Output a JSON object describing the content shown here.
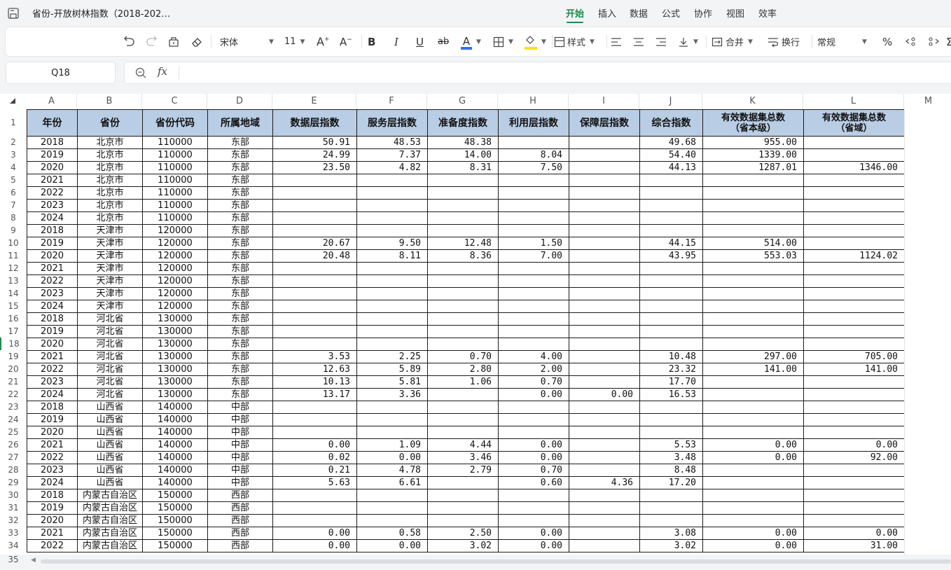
{
  "app": {
    "doc_title": "省份-开放树林指数（2018-202…",
    "menu_tabs": [
      "开始",
      "插入",
      "数据",
      "公式",
      "协作",
      "视图",
      "效率"
    ],
    "active_tab": "开始"
  },
  "toolbar": {
    "font_name": "宋体",
    "font_size": "11",
    "style_label": "样式",
    "merge_label": "合并",
    "wrap_label": "换行",
    "number_format": "常规",
    "percent": "%",
    "bold": "B",
    "italic": "I",
    "underline": "U",
    "strike": "ab",
    "font_color_glyph": "A",
    "accent_color": "#1f8a4c",
    "font_color_bar": "#3370ff",
    "fill_color_bar": "#ffe100"
  },
  "formula_bar": {
    "cell_ref": "Q18",
    "fx": "fx",
    "value": ""
  },
  "sheet": {
    "column_letters": [
      "A",
      "B",
      "C",
      "D",
      "E",
      "F",
      "G",
      "H",
      "I",
      "J",
      "K",
      "L",
      "M"
    ],
    "headers": [
      "年份",
      "省份",
      "省份代码",
      "所属地域",
      "数据层指数",
      "服务层指数",
      "准备度指数",
      "利用层指数",
      "保障层指数",
      "综合指数",
      "有效数据集总数\n（省本级）",
      "有效数据集总数\n（省域）"
    ],
    "rows": [
      [
        "2018",
        "北京市",
        "110000",
        "东部",
        "50.91",
        "48.53",
        "48.38",
        "",
        "",
        "49.68",
        "955.00",
        ""
      ],
      [
        "2019",
        "北京市",
        "110000",
        "东部",
        "24.99",
        "7.37",
        "14.00",
        "8.04",
        "",
        "54.40",
        "1339.00",
        ""
      ],
      [
        "2020",
        "北京市",
        "110000",
        "东部",
        "23.50",
        "4.82",
        "8.31",
        "7.50",
        "",
        "44.13",
        "1287.01",
        "1346.00"
      ],
      [
        "2021",
        "北京市",
        "110000",
        "东部",
        "",
        "",
        "",
        "",
        "",
        "",
        "",
        ""
      ],
      [
        "2022",
        "北京市",
        "110000",
        "东部",
        "",
        "",
        "",
        "",
        "",
        "",
        "",
        ""
      ],
      [
        "2023",
        "北京市",
        "110000",
        "东部",
        "",
        "",
        "",
        "",
        "",
        "",
        "",
        ""
      ],
      [
        "2024",
        "北京市",
        "110000",
        "东部",
        "",
        "",
        "",
        "",
        "",
        "",
        "",
        ""
      ],
      [
        "2018",
        "天津市",
        "120000",
        "东部",
        "",
        "",
        "",
        "",
        "",
        "",
        "",
        ""
      ],
      [
        "2019",
        "天津市",
        "120000",
        "东部",
        "20.67",
        "9.50",
        "12.48",
        "1.50",
        "",
        "44.15",
        "514.00",
        ""
      ],
      [
        "2020",
        "天津市",
        "120000",
        "东部",
        "20.48",
        "8.11",
        "8.36",
        "7.00",
        "",
        "43.95",
        "553.03",
        "1124.02"
      ],
      [
        "2021",
        "天津市",
        "120000",
        "东部",
        "",
        "",
        "",
        "",
        "",
        "",
        "",
        ""
      ],
      [
        "2022",
        "天津市",
        "120000",
        "东部",
        "",
        "",
        "",
        "",
        "",
        "",
        "",
        ""
      ],
      [
        "2023",
        "天津市",
        "120000",
        "东部",
        "",
        "",
        "",
        "",
        "",
        "",
        "",
        ""
      ],
      [
        "2024",
        "天津市",
        "120000",
        "东部",
        "",
        "",
        "",
        "",
        "",
        "",
        "",
        ""
      ],
      [
        "2018",
        "河北省",
        "130000",
        "东部",
        "",
        "",
        "",
        "",
        "",
        "",
        "",
        ""
      ],
      [
        "2019",
        "河北省",
        "130000",
        "东部",
        "",
        "",
        "",
        "",
        "",
        "",
        "",
        ""
      ],
      [
        "2020",
        "河北省",
        "130000",
        "东部",
        "",
        "",
        "",
        "",
        "",
        "",
        "",
        ""
      ],
      [
        "2021",
        "河北省",
        "130000",
        "东部",
        "3.53",
        "2.25",
        "0.70",
        "4.00",
        "",
        "10.48",
        "297.00",
        "705.00"
      ],
      [
        "2022",
        "河北省",
        "130000",
        "东部",
        "12.63",
        "5.89",
        "2.80",
        "2.00",
        "",
        "23.32",
        "141.00",
        "141.00"
      ],
      [
        "2023",
        "河北省",
        "130000",
        "东部",
        "10.13",
        "5.81",
        "1.06",
        "0.70",
        "",
        "17.70",
        "",
        ""
      ],
      [
        "2024",
        "河北省",
        "130000",
        "东部",
        "13.17",
        "3.36",
        "",
        "0.00",
        "0.00",
        "16.53",
        "",
        ""
      ],
      [
        "2018",
        "山西省",
        "140000",
        "中部",
        "",
        "",
        "",
        "",
        "",
        "",
        "",
        ""
      ],
      [
        "2019",
        "山西省",
        "140000",
        "中部",
        "",
        "",
        "",
        "",
        "",
        "",
        "",
        ""
      ],
      [
        "2020",
        "山西省",
        "140000",
        "中部",
        "",
        "",
        "",
        "",
        "",
        "",
        "",
        ""
      ],
      [
        "2021",
        "山西省",
        "140000",
        "中部",
        "0.00",
        "1.09",
        "4.44",
        "0.00",
        "",
        "5.53",
        "0.00",
        "0.00"
      ],
      [
        "2022",
        "山西省",
        "140000",
        "中部",
        "0.02",
        "0.00",
        "3.46",
        "0.00",
        "",
        "3.48",
        "0.00",
        "92.00"
      ],
      [
        "2023",
        "山西省",
        "140000",
        "中部",
        "0.21",
        "4.78",
        "2.79",
        "0.70",
        "",
        "8.48",
        "",
        ""
      ],
      [
        "2024",
        "山西省",
        "140000",
        "中部",
        "5.63",
        "6.61",
        "",
        "0.60",
        "4.36",
        "17.20",
        "",
        ""
      ],
      [
        "2018",
        "内蒙古自治区",
        "150000",
        "西部",
        "",
        "",
        "",
        "",
        "",
        "",
        "",
        ""
      ],
      [
        "2019",
        "内蒙古自治区",
        "150000",
        "西部",
        "",
        "",
        "",
        "",
        "",
        "",
        "",
        ""
      ],
      [
        "2020",
        "内蒙古自治区",
        "150000",
        "西部",
        "",
        "",
        "",
        "",
        "",
        "",
        "",
        ""
      ],
      [
        "2021",
        "内蒙古自治区",
        "150000",
        "西部",
        "0.00",
        "0.58",
        "2.50",
        "0.00",
        "",
        "3.08",
        "0.00",
        "0.00"
      ],
      [
        "2022",
        "内蒙古自治区",
        "150000",
        "西部",
        "0.00",
        "0.00",
        "3.02",
        "0.00",
        "",
        "3.02",
        "0.00",
        "31.00"
      ]
    ],
    "row_numbers": [
      "1",
      "2",
      "3",
      "4",
      "5",
      "6",
      "7",
      "8",
      "9",
      "10",
      "11",
      "12",
      "13",
      "14",
      "15",
      "16",
      "17",
      "18",
      "19",
      "20",
      "21",
      "22",
      "23",
      "24",
      "25",
      "26",
      "27",
      "28",
      "29",
      "30",
      "31",
      "32",
      "33",
      "34",
      "35"
    ],
    "header_fill": "#b9cde5",
    "selected_row_number": "18"
  }
}
